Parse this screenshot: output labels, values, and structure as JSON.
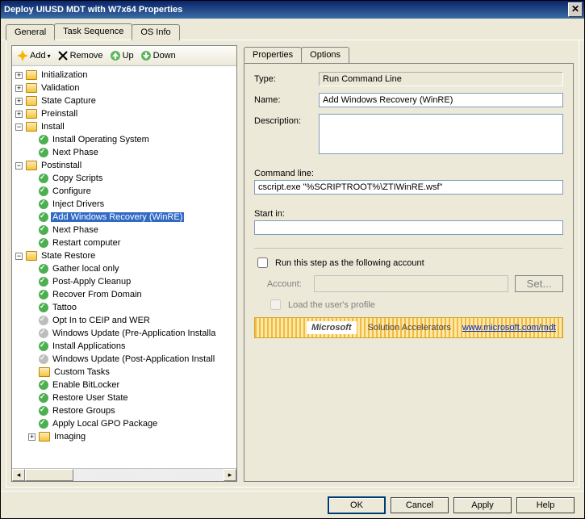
{
  "title": "Deploy UIUSD MDT with W7x64 Properties",
  "main_tabs": {
    "general": "General",
    "task_sequence": "Task Sequence",
    "os_info": "OS Info"
  },
  "toolbar": {
    "add": "Add",
    "remove": "Remove",
    "up": "Up",
    "down": "Down"
  },
  "tree": {
    "initialization": "Initialization",
    "validation": "Validation",
    "state_capture": "State Capture",
    "preinstall": "Preinstall",
    "install": "Install",
    "install_os": "Install Operating System",
    "next_phase": "Next Phase",
    "postinstall": "Postinstall",
    "copy_scripts": "Copy Scripts",
    "configure": "Configure",
    "inject_drivers": "Inject Drivers",
    "add_winre": "Add Windows Recovery (WinRE)",
    "next_phase2": "Next Phase",
    "restart": "Restart computer",
    "state_restore": "State Restore",
    "gather": "Gather local only",
    "post_apply": "Post-Apply Cleanup",
    "recover_domain": "Recover From Domain",
    "tattoo": "Tattoo",
    "ceip": "Opt In to CEIP and WER",
    "wu_pre": "Windows Update (Pre-Application Installa",
    "install_apps": "Install Applications",
    "wu_post": "Windows Update (Post-Application Install",
    "custom_tasks": "Custom Tasks",
    "bitlocker": "Enable BitLocker",
    "restore_user": "Restore User State",
    "restore_groups": "Restore Groups",
    "gpo": "Apply Local GPO Package",
    "imaging": "Imaging"
  },
  "sub_tabs": {
    "properties": "Properties",
    "options": "Options"
  },
  "props": {
    "type_label": "Type:",
    "type_value": "Run Command Line",
    "name_label": "Name:",
    "name_value": "Add Windows Recovery (WinRE)",
    "desc_label": "Description:",
    "desc_value": "",
    "cmd_label": "Command line:",
    "cmd_value": "cscript.exe \"%SCRIPTROOT%\\ZTIWinRE.wsf\"",
    "start_label": "Start in:",
    "start_value": "",
    "run_as_label": "Run this step as the following account",
    "account_label": "Account:",
    "set_button": "Set...",
    "load_profile": "Load the user's profile"
  },
  "footer": {
    "brand": "Microsoft",
    "product": "Solution Accelerators",
    "link": "www.microsoft.com/mdt"
  },
  "buttons": {
    "ok": "OK",
    "cancel": "Cancel",
    "apply": "Apply",
    "help": "Help"
  }
}
